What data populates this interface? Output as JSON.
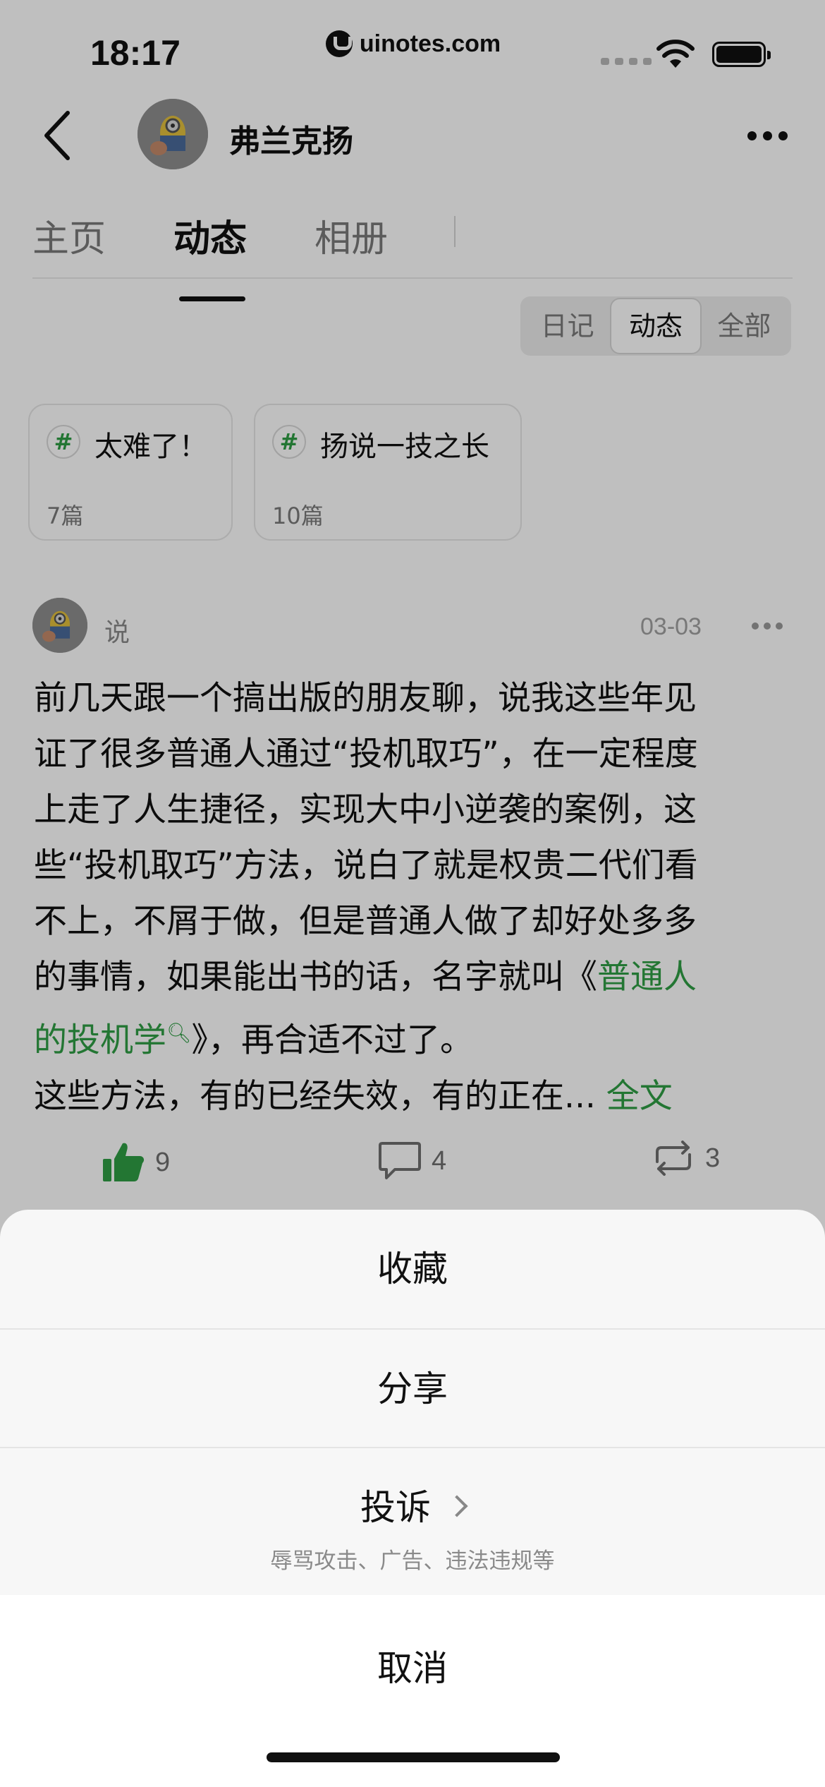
{
  "status_bar": {
    "time": "18:17",
    "url": "uinotes.com"
  },
  "header": {
    "profile_name": "弗兰克扬"
  },
  "tabs": [
    {
      "label": "主页",
      "active": false
    },
    {
      "label": "动态",
      "active": true
    },
    {
      "label": "相册",
      "active": false
    }
  ],
  "segments": [
    {
      "label": "日记",
      "active": false
    },
    {
      "label": "动态",
      "active": true
    },
    {
      "label": "全部",
      "active": false
    }
  ],
  "topics": [
    {
      "hash": "#",
      "title": "太难了！",
      "count": "7篇"
    },
    {
      "hash": "#",
      "title": "扬说一技之长",
      "count": "10篇"
    }
  ],
  "post": {
    "type": "说",
    "date": "03-03",
    "lines": [
      "前几天跟一个搞出版的朋友聊，说我这些年见",
      "证了很多普通人通过“投机取巧”，在一定程度",
      "上走了人生捷径，实现大中小逆袭的案例，这",
      "些“投机取巧”方法，说白了就是权贵二代们看",
      "不上，不屑于做，但是普通人做了却好处多多"
    ],
    "line6_prefix": "的事情，如果能出书的话，名字就叫《",
    "book_link_part1": "普通人",
    "book_link_part2": "的投机学",
    "line7_suffix": "》，再合适不过了。",
    "line8_text": "这些方法，有的已经失效，有的正在...",
    "read_more": "全文"
  },
  "actions": {
    "likes": "9",
    "comments": "4",
    "reposts": "3"
  },
  "sheet": {
    "favorite": "收藏",
    "share": "分享",
    "report": "投诉",
    "report_sub": "辱骂攻击、广告、违法违规等",
    "cancel": "取消"
  },
  "colors": {
    "accent_green": "#2f9e45",
    "overlay": "rgba(0,0,0,0.25)"
  }
}
